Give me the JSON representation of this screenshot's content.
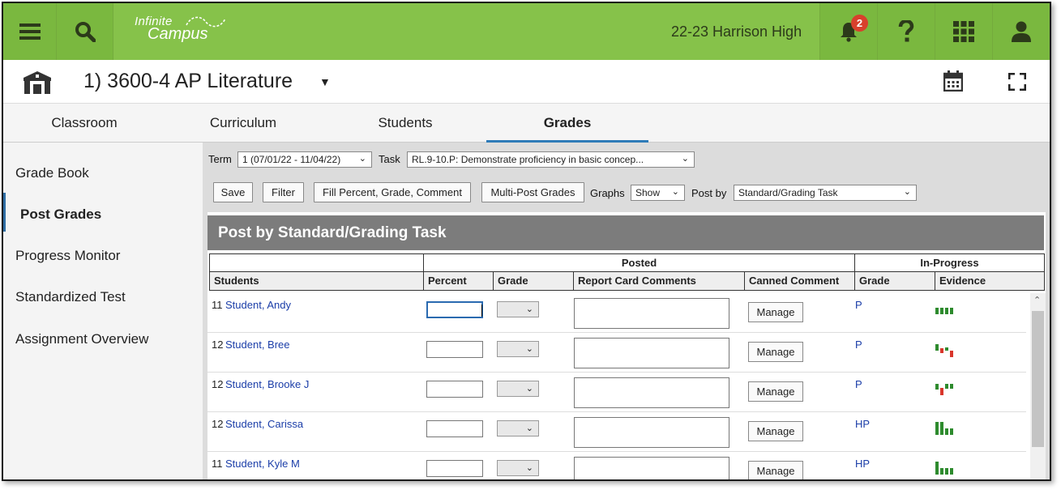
{
  "topbar": {
    "logo_line1": "Infinite",
    "logo_line2": "Campus",
    "school": "22-23 Harrison High",
    "notification_count": "2",
    "icons": [
      "menu-icon",
      "search-icon",
      "bell-icon",
      "help-icon",
      "apps-grid-icon",
      "user-icon"
    ],
    "color": "#86c24a"
  },
  "header": {
    "title": "1) 3600-4 AP Literature"
  },
  "tabs": [
    {
      "label": "Classroom"
    },
    {
      "label": "Curriculum"
    },
    {
      "label": "Students"
    },
    {
      "label": "Grades"
    }
  ],
  "sidebar": {
    "items": [
      {
        "label": "Grade Book"
      },
      {
        "label": "Post Grades"
      },
      {
        "label": "Progress Monitor"
      },
      {
        "label": "Standardized Test"
      },
      {
        "label": "Assignment Overview"
      }
    ],
    "active": "Post Grades"
  },
  "filters": {
    "term_label": "Term",
    "term_value": "1 (07/01/22 - 11/04/22)",
    "task_label": "Task",
    "task_value": "RL.9-10.P: Demonstrate proficiency in basic concep...",
    "graphs_label": "Graphs",
    "graphs_value": "Show",
    "postby_label": "Post by",
    "postby_value": "Standard/Grading Task"
  },
  "toolbar": {
    "save": "Save",
    "filter": "Filter",
    "fill": "Fill Percent, Grade, Comment",
    "multipost": "Multi-Post Grades"
  },
  "panel": {
    "title": "Post by Standard/Grading Task",
    "group_posted": "Posted",
    "group_inprogress": "In-Progress",
    "columns": {
      "students": "Students",
      "percent": "Percent",
      "grade": "Grade",
      "rcc": "Report Card Comments",
      "canned": "Canned Comment",
      "ip_grade": "Grade",
      "evidence": "Evidence"
    },
    "manage_label": "Manage",
    "rows": [
      {
        "num": "11",
        "name": "Student, Andy",
        "ip_grade": "P"
      },
      {
        "num": "12",
        "name": "Student, Bree",
        "ip_grade": "P"
      },
      {
        "num": "12",
        "name": "Student, Brooke J",
        "ip_grade": "P"
      },
      {
        "num": "12",
        "name": "Student, Carissa",
        "ip_grade": "HP"
      },
      {
        "num": "11",
        "name": "Student, Kyle M",
        "ip_grade": "HP"
      }
    ]
  },
  "colors": {
    "evidence_green": "#2e8b2e",
    "evidence_red": "#d9362b",
    "link_blue": "#1a3da8"
  }
}
